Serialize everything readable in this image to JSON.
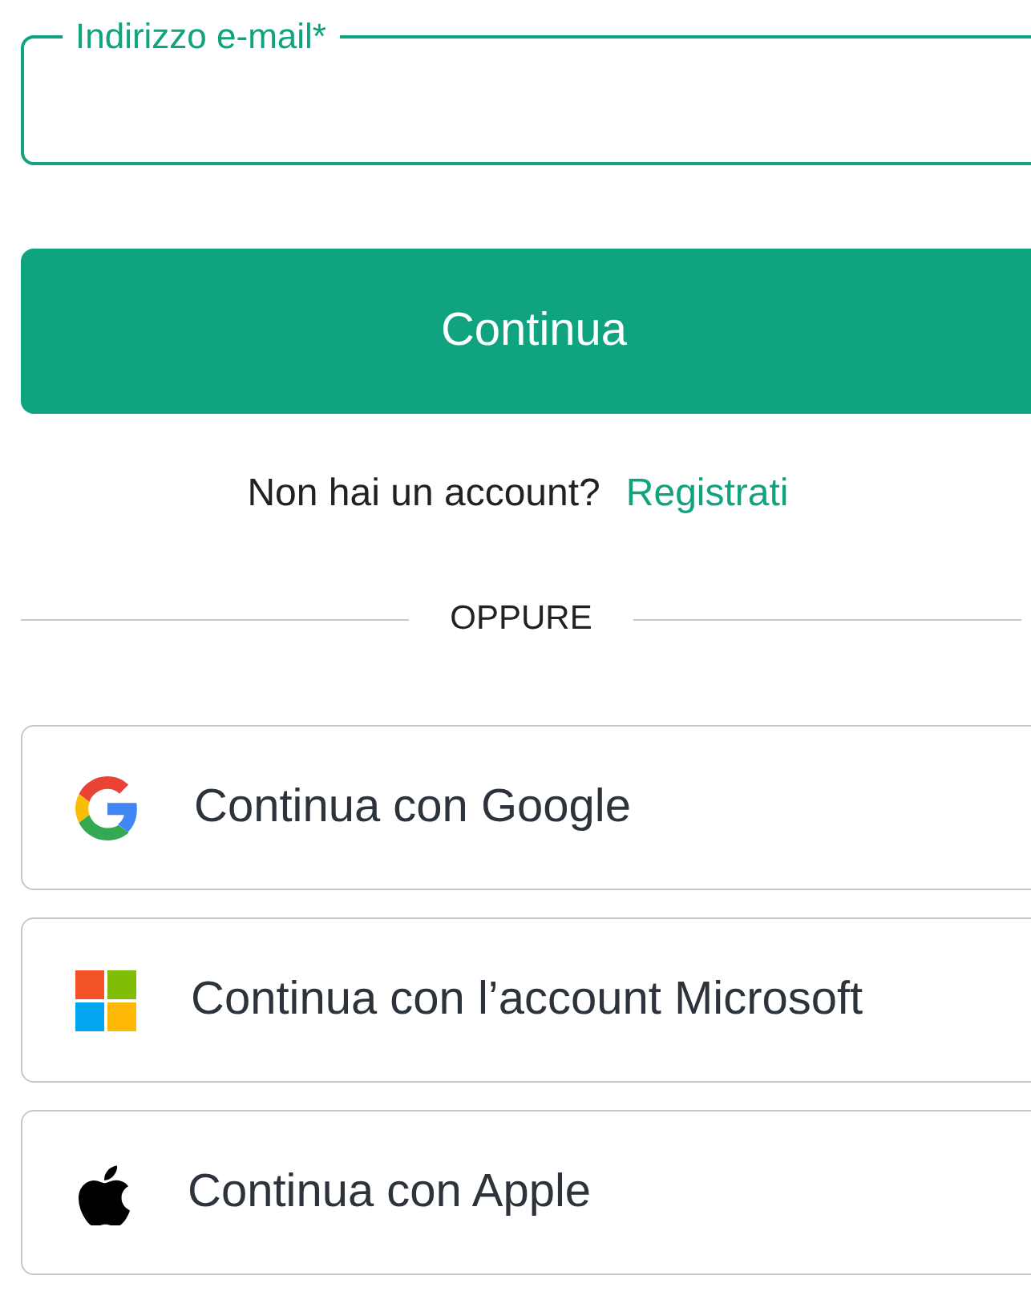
{
  "email_field": {
    "label": "Indirizzo e-mail*"
  },
  "continue_button": "Continua",
  "signup": {
    "prompt": "Non hai un account?",
    "link": "Registrati"
  },
  "divider": "OPPURE",
  "social_buttons": [
    {
      "kind": "google",
      "label": "Continua con Google"
    },
    {
      "kind": "microsoft",
      "label": "Continua con l’account Microsoft"
    },
    {
      "kind": "apple",
      "label": "Continua con Apple"
    }
  ]
}
